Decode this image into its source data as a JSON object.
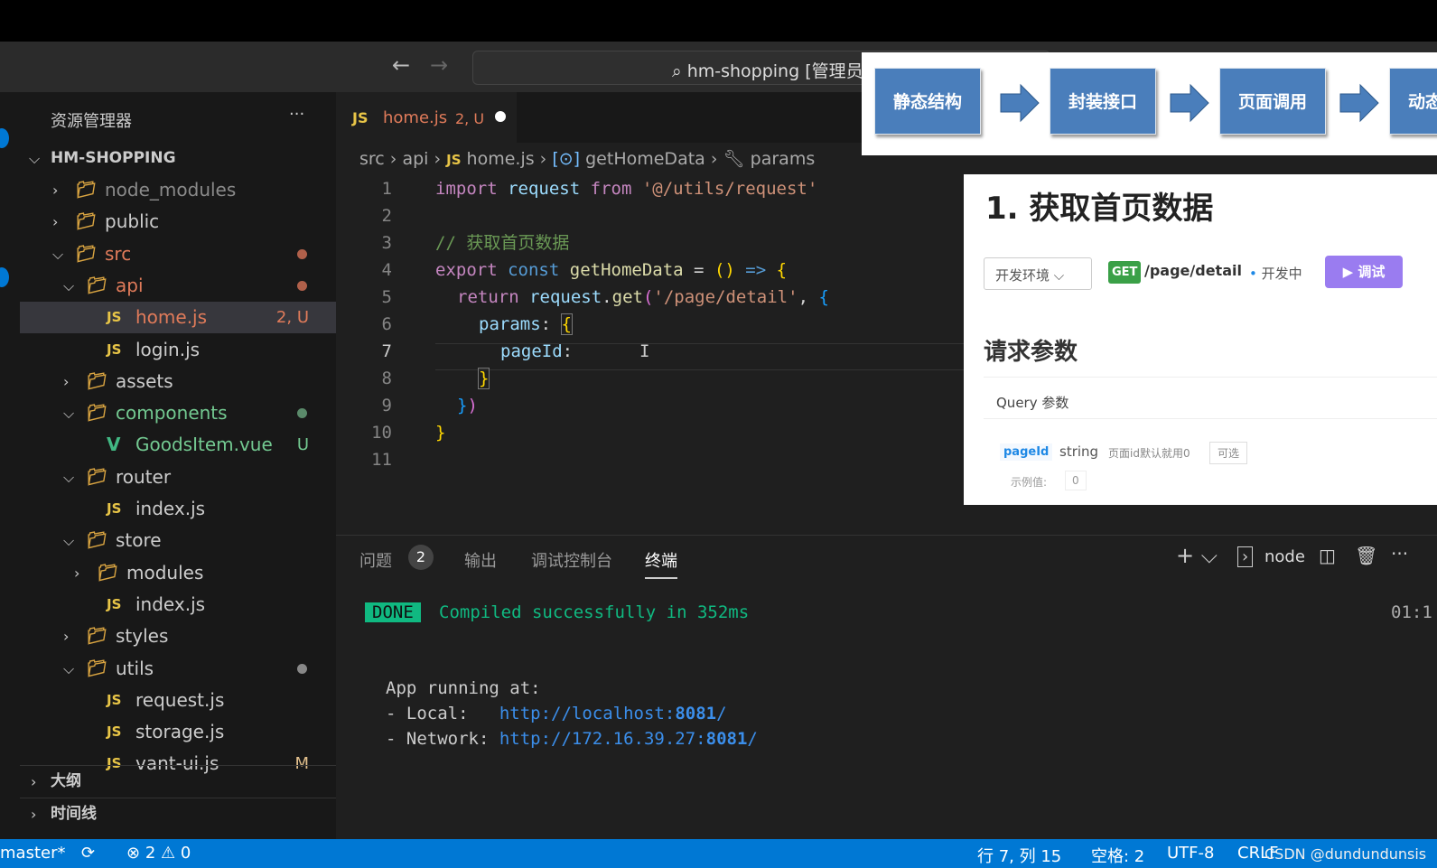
{
  "titlebar": {
    "search": "hm-shopping [管理员]"
  },
  "sidebar": {
    "title": "资源管理器",
    "more": "···",
    "root": "HM-SHOPPING",
    "items": [
      {
        "label": "node_modules",
        "depth": 1,
        "chev": ">",
        "icon": "folder-node",
        "color": "#8a8a8a"
      },
      {
        "label": "public",
        "depth": 1,
        "chev": ">",
        "icon": "folder-public",
        "color": "#ccc"
      },
      {
        "label": "src",
        "depth": 1,
        "chev": "v",
        "icon": "folder-src",
        "color": "#e07b5a",
        "dot": "#b0604a"
      },
      {
        "label": "api",
        "depth": 2,
        "chev": "v",
        "icon": "folder-api",
        "color": "#e07b5a",
        "dot": "#b0604a"
      },
      {
        "label": "home.js",
        "depth": 3,
        "icon": "js",
        "color": "#e07b5a",
        "status": "2, U",
        "selected": true
      },
      {
        "label": "login.js",
        "depth": 3,
        "icon": "js",
        "color": "#ccc"
      },
      {
        "label": "assets",
        "depth": 2,
        "chev": ">",
        "icon": "folder-assets",
        "color": "#ccc"
      },
      {
        "label": "components",
        "depth": 2,
        "chev": "v",
        "icon": "folder-components",
        "color": "#73c991",
        "dot": "#5a8a6a"
      },
      {
        "label": "GoodsItem.vue",
        "depth": 3,
        "icon": "vue",
        "color": "#73c991",
        "status": "U"
      },
      {
        "label": "router",
        "depth": 2,
        "chev": "v",
        "icon": "folder-router",
        "color": "#ccc"
      },
      {
        "label": "index.js",
        "depth": 3,
        "icon": "js",
        "color": "#ccc"
      },
      {
        "label": "store",
        "depth": 2,
        "chev": "v",
        "icon": "folder-store",
        "color": "#ccc"
      },
      {
        "label": "modules",
        "depth": 3,
        "chev": ">",
        "icon": "folder-modules",
        "color": "#ccc"
      },
      {
        "label": "index.js",
        "depth": 3,
        "icon": "js",
        "color": "#ccc"
      },
      {
        "label": "styles",
        "depth": 2,
        "chev": ">",
        "icon": "folder-styles",
        "color": "#ccc"
      },
      {
        "label": "utils",
        "depth": 2,
        "chev": "v",
        "icon": "folder-utils",
        "color": "#ccc",
        "dot": "#888"
      },
      {
        "label": "request.js",
        "depth": 3,
        "icon": "js",
        "color": "#ccc"
      },
      {
        "label": "storage.js",
        "depth": 3,
        "icon": "js",
        "color": "#ccc"
      },
      {
        "label": "vant-ui.js",
        "depth": 3,
        "icon": "js",
        "color": "#ccc",
        "status": "M"
      }
    ],
    "outline": "大纲",
    "timeline": "时间线"
  },
  "editor": {
    "tab": {
      "icon": "JS",
      "name": "home.js",
      "badge": "2, U"
    },
    "breadcrumb": [
      "src",
      "api",
      "home.js",
      "getHomeData",
      "params"
    ],
    "current_line": 7
  },
  "panel": {
    "tabs": [
      "问题",
      "输出",
      "调试控制台",
      "终端"
    ],
    "problems_count": "2",
    "active": "终端",
    "shell": "node",
    "done": "DONE",
    "compiled": "Compiled successfully in 352ms",
    "time": "01:1",
    "running": "App running at:",
    "local_label": "- Local:   ",
    "local_url": "http://localhost:",
    "local_port": "8081",
    "net_label": "- Network: ",
    "net_url": "http://172.16.39.27:",
    "net_port": "8081"
  },
  "status": {
    "branch": "master*",
    "errors": "2",
    "warnings": "0",
    "position": "行 7, 列 15",
    "spaces": "空格: 2",
    "encoding": "UTF-8",
    "eol": "CRLF",
    "watermark": "CSDN @dundundunsis"
  },
  "flow": {
    "steps": [
      "静态结构",
      "封装接口",
      "页面调用",
      "动态"
    ]
  },
  "doc": {
    "title": "1. 获取首页数据",
    "env": "开发环境",
    "method": "GET",
    "path": "/page/detail",
    "state": "开发中",
    "debug": "调试",
    "section": "请求参数",
    "query": "Query 参数",
    "param_name": "pageId",
    "param_type": "string",
    "param_desc": "页面id默认就用0",
    "optional": "可选",
    "example_label": "示例值:",
    "example": "0"
  }
}
